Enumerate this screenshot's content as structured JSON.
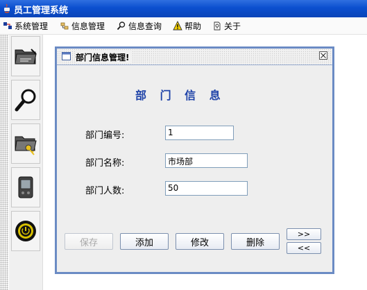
{
  "window": {
    "title": "员工管理系统"
  },
  "menu": [
    {
      "label": "系统管理",
      "icon": "system-icon"
    },
    {
      "label": "信息管理",
      "icon": "info-manage-icon"
    },
    {
      "label": "信息查询",
      "icon": "search-icon"
    },
    {
      "label": "帮助",
      "icon": "warning-icon"
    },
    {
      "label": "关于",
      "icon": "about-icon"
    }
  ],
  "toolbar": [
    {
      "icon": "folder-edit-icon"
    },
    {
      "icon": "magnifier-icon"
    },
    {
      "icon": "folder-key-icon"
    },
    {
      "icon": "pda-icon"
    },
    {
      "icon": "power-icon"
    }
  ],
  "frame": {
    "title": "部门信息管理!",
    "heading": "部 门 信 息",
    "fields": [
      {
        "label": "部门编号:",
        "value": "1"
      },
      {
        "label": "部门名称:",
        "value": "市场部"
      },
      {
        "label": "部门人数:",
        "value": "50"
      }
    ],
    "buttons": {
      "save": "保存",
      "add": "添加",
      "edit": "修改",
      "delete": "删除",
      "next": ">>",
      "prev": "<<"
    }
  },
  "colors": {
    "title_bar": "#0b4fcf",
    "heading": "#1f43a8",
    "frame_border": "#6b8bc4"
  }
}
